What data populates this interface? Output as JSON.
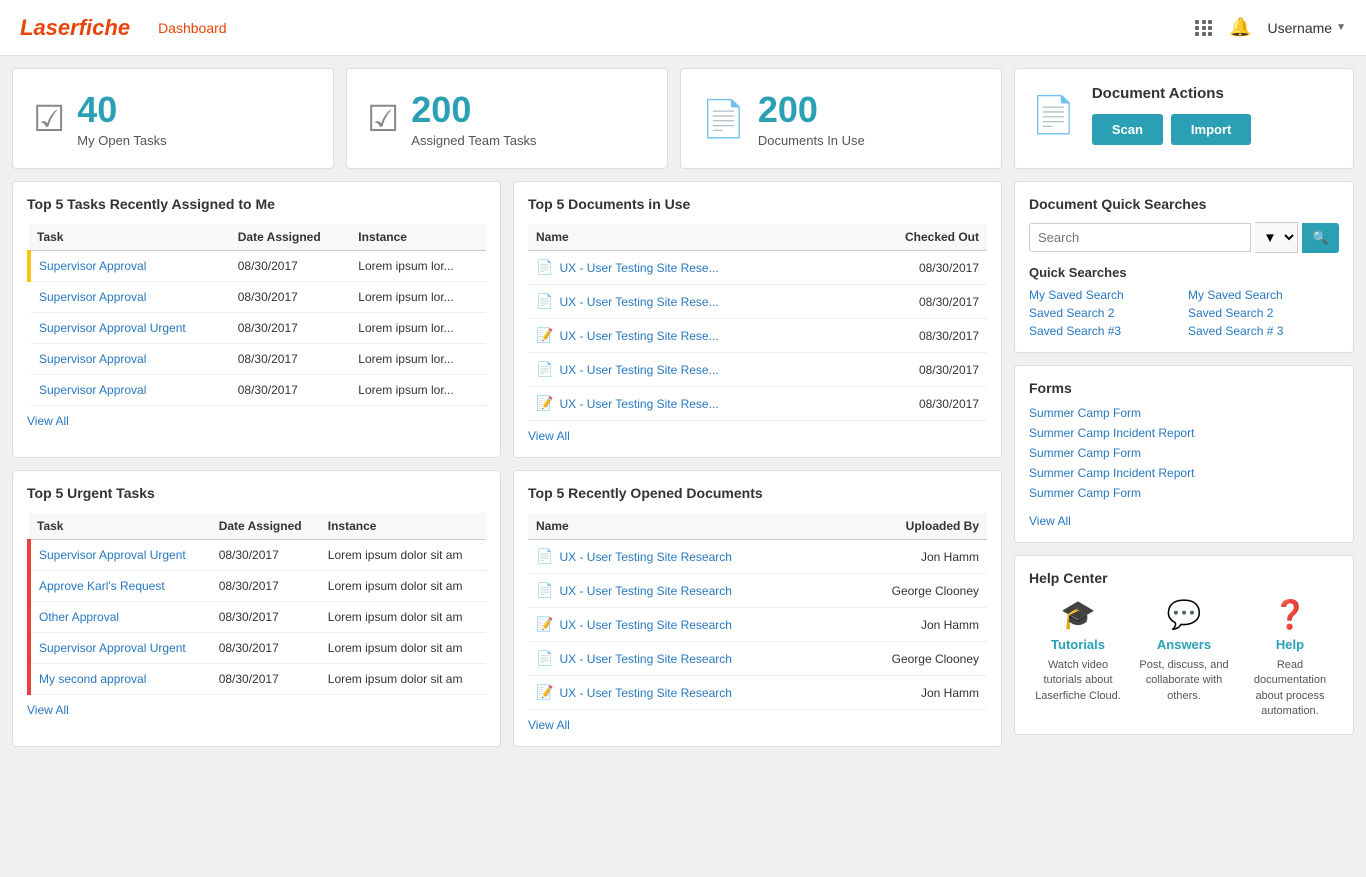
{
  "header": {
    "logo": "Laserfiche",
    "nav_link": "Dashboard",
    "username": "Username"
  },
  "stats": [
    {
      "number": "40",
      "label": "My Open Tasks",
      "icon": "✔"
    },
    {
      "number": "200",
      "label": "Assigned Team Tasks",
      "icon": "✔"
    },
    {
      "number": "200",
      "label": "Documents In Use",
      "icon": "📄"
    }
  ],
  "doc_actions": {
    "title": "Document Actions",
    "scan_label": "Scan",
    "import_label": "Import"
  },
  "top_tasks": {
    "title": "Top 5 Tasks Recently Assigned to Me",
    "columns": [
      "Task",
      "Date Assigned",
      "Instance"
    ],
    "rows": [
      {
        "task": "Supervisor Approval",
        "date": "08/30/2017",
        "instance": "Lorem ipsum lor...",
        "priority": "yellow"
      },
      {
        "task": "Supervisor Approval",
        "date": "08/30/2017",
        "instance": "Lorem ipsum lor...",
        "priority": "none"
      },
      {
        "task": "Supervisor Approval Urgent",
        "date": "08/30/2017",
        "instance": "Lorem ipsum lor...",
        "priority": "none"
      },
      {
        "task": "Supervisor Approval",
        "date": "08/30/2017",
        "instance": "Lorem ipsum lor...",
        "priority": "none"
      },
      {
        "task": "Supervisor Approval",
        "date": "08/30/2017",
        "instance": "Lorem ipsum lor...",
        "priority": "none"
      }
    ],
    "view_all": "View All"
  },
  "urgent_tasks": {
    "title": "Top 5 Urgent Tasks",
    "columns": [
      "Task",
      "Date Assigned",
      "Instance"
    ],
    "rows": [
      {
        "task": "Supervisor Approval Urgent",
        "date": "08/30/2017",
        "instance": "Lorem ipsum dolor sit am",
        "priority": "red"
      },
      {
        "task": "Approve Karl's Request",
        "date": "08/30/2017",
        "instance": "Lorem ipsum dolor sit am",
        "priority": "red"
      },
      {
        "task": "Other Approval",
        "date": "08/30/2017",
        "instance": "Lorem ipsum dolor sit am",
        "priority": "red"
      },
      {
        "task": "Supervisor Approval Urgent",
        "date": "08/30/2017",
        "instance": "Lorem ipsum dolor sit am",
        "priority": "red"
      },
      {
        "task": "My second approval",
        "date": "08/30/2017",
        "instance": "Lorem ipsum dolor sit am",
        "priority": "red"
      }
    ],
    "view_all": "View All"
  },
  "top_docs_in_use": {
    "title": "Top 5 Documents in Use",
    "columns": [
      "Name",
      "Checked Out"
    ],
    "rows": [
      {
        "name": "UX - User Testing Site Rese...",
        "date": "08/30/2017",
        "type": "pdf"
      },
      {
        "name": "UX - User Testing Site Rese...",
        "date": "08/30/2017",
        "type": "pdf"
      },
      {
        "name": "UX - User Testing Site Rese...",
        "date": "08/30/2017",
        "type": "word"
      },
      {
        "name": "UX - User Testing Site Rese...",
        "date": "08/30/2017",
        "type": "pdf"
      },
      {
        "name": "UX - User Testing Site Rese...",
        "date": "08/30/2017",
        "type": "word"
      }
    ],
    "view_all": "View All"
  },
  "recently_opened": {
    "title": "Top 5 Recently Opened Documents",
    "columns": [
      "Name",
      "Uploaded By"
    ],
    "rows": [
      {
        "name": "UX - User Testing Site Research",
        "uploaded_by": "Jon Hamm",
        "type": "pdf"
      },
      {
        "name": "UX - User Testing Site Research",
        "uploaded_by": "George Clooney",
        "type": "pdf"
      },
      {
        "name": "UX - User Testing Site Research",
        "uploaded_by": "Jon Hamm",
        "type": "word"
      },
      {
        "name": "UX - User Testing Site Research",
        "uploaded_by": "George Clooney",
        "type": "pdf"
      },
      {
        "name": "UX - User Testing Site Research",
        "uploaded_by": "Jon Hamm",
        "type": "word"
      }
    ],
    "view_all": "View All"
  },
  "quick_searches": {
    "section_title": "Document Quick Searches",
    "search_placeholder": "Search",
    "subsection_title": "Quick Searches",
    "items_col1": [
      "My Saved Search",
      "Saved Search 2",
      "Saved Search #3"
    ],
    "items_col2": [
      "My Saved Search",
      "Saved Search 2",
      "Saved Search # 3"
    ]
  },
  "forms": {
    "title": "Forms",
    "items": [
      "Summer Camp Form",
      "Summer Camp Incident Report",
      "Summer Camp Form",
      "Summer Camp Incident Report",
      "Summer Camp Form"
    ],
    "view_all": "View All"
  },
  "help_center": {
    "title": "Help Center",
    "items": [
      {
        "label": "Tutorials",
        "icon": "🎓",
        "desc": "Watch video tutorials about Laserfiche Cloud."
      },
      {
        "label": "Answers",
        "icon": "💬",
        "desc": "Post, discuss, and collaborate with others."
      },
      {
        "label": "Help",
        "icon": "❓",
        "desc": "Read documentation about process automation."
      }
    ]
  }
}
